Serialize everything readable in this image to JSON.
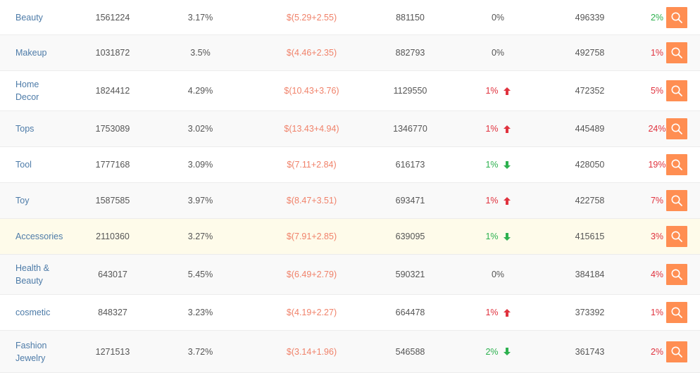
{
  "rows": [
    {
      "category": "Beauty",
      "col2": "1561224",
      "col3": "3.17%",
      "col4": "$(5.29+2.55)",
      "col5": "881150",
      "col6": {
        "text": "0%",
        "dir": "zero"
      },
      "col7": "496339",
      "col8": {
        "text": "2%",
        "dir": "down"
      },
      "style": "odd",
      "height": 50
    },
    {
      "category": "Makeup",
      "col2": "1031872",
      "col3": "3.5%",
      "col4": "$(4.46+2.35)",
      "col5": "882793",
      "col6": {
        "text": "0%",
        "dir": "zero"
      },
      "col7": "492758",
      "col8": {
        "text": "1%",
        "dir": "up"
      },
      "style": "even",
      "height": 51
    },
    {
      "category": "Home Decor",
      "col2": "1824412",
      "col3": "4.29%",
      "col4": "$(10.43+3.76)",
      "col5": "1129550",
      "col6": {
        "text": "1%",
        "dir": "up"
      },
      "col7": "472352",
      "col8": {
        "text": "5%",
        "dir": "up"
      },
      "style": "odd",
      "height": 57
    },
    {
      "category": "Tops",
      "col2": "1753089",
      "col3": "3.02%",
      "col4": "$(13.43+4.94)",
      "col5": "1346770",
      "col6": {
        "text": "1%",
        "dir": "up"
      },
      "col7": "445489",
      "col8": {
        "text": "24%",
        "dir": "up"
      },
      "style": "even",
      "height": 51
    },
    {
      "category": "Tool",
      "col2": "1777168",
      "col3": "3.09%",
      "col4": "$(7.11+2.84)",
      "col5": "616173",
      "col6": {
        "text": "1%",
        "dir": "down"
      },
      "col7": "428050",
      "col8": {
        "text": "19%",
        "dir": "up"
      },
      "style": "odd",
      "height": 51
    },
    {
      "category": "Toy",
      "col2": "1587585",
      "col3": "3.97%",
      "col4": "$(8.47+3.51)",
      "col5": "693471",
      "col6": {
        "text": "1%",
        "dir": "up"
      },
      "col7": "422758",
      "col8": {
        "text": "7%",
        "dir": "up"
      },
      "style": "even",
      "height": 51
    },
    {
      "category": "Accessories",
      "col2": "2110360",
      "col3": "3.27%",
      "col4": "$(7.91+2.85)",
      "col5": "639095",
      "col6": {
        "text": "1%",
        "dir": "down"
      },
      "col7": "415615",
      "col8": {
        "text": "3%",
        "dir": "up"
      },
      "style": "highlight",
      "height": 51
    },
    {
      "category": "Health & Beauty",
      "col2": "643017",
      "col3": "5.45%",
      "col4": "$(6.49+2.79)",
      "col5": "590321",
      "col6": {
        "text": "0%",
        "dir": "zero"
      },
      "col7": "384184",
      "col8": {
        "text": "4%",
        "dir": "up"
      },
      "style": "even",
      "height": 57
    },
    {
      "category": "cosmetic",
      "col2": "848327",
      "col3": "3.23%",
      "col4": "$(4.19+2.27)",
      "col5": "664478",
      "col6": {
        "text": "1%",
        "dir": "up"
      },
      "col7": "373392",
      "col8": {
        "text": "1%",
        "dir": "up"
      },
      "style": "odd",
      "height": 51
    },
    {
      "category": "Fashion Jewelry",
      "col2": "1271513",
      "col3": "3.72%",
      "col4": "$(3.14+1.96)",
      "col5": "546588",
      "col6": {
        "text": "2%",
        "dir": "down"
      },
      "col7": "361743",
      "col8": {
        "text": "2%",
        "dir": "up"
      },
      "style": "even",
      "height": 60
    }
  ],
  "icons": {
    "up": "arrow-up-icon",
    "down": "arrow-down-icon",
    "search": "search-icon"
  },
  "colors": {
    "up": "#e0323e",
    "down": "#2db14f",
    "accent": "#ff8e52",
    "link": "#4d7ba8",
    "price": "#f0826a"
  }
}
